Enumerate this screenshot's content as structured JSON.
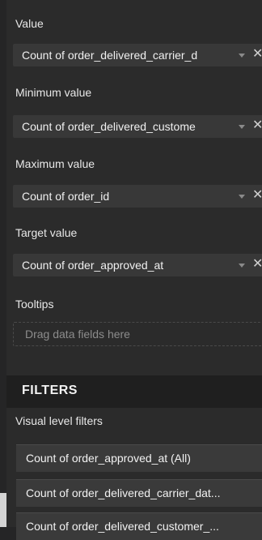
{
  "fields": {
    "value": {
      "label": "Value",
      "field": "Count of order_delivered_carrier_d"
    },
    "minimum_value": {
      "label": "Minimum value",
      "field": "Count of order_delivered_custome"
    },
    "maximum_value": {
      "label": "Maximum value",
      "field": "Count of order_id"
    },
    "target_value": {
      "label": "Target value",
      "field": "Count of order_approved_at"
    },
    "tooltips": {
      "label": "Tooltips",
      "placeholder": "Drag data fields here"
    }
  },
  "filters": {
    "header": "FILTERS",
    "visual_level_label": "Visual level filters",
    "items": [
      "Count of order_approved_at  (All)",
      "Count of order_delivered_carrier_dat...",
      "Count of order_delivered_customer_..."
    ]
  },
  "icons": {
    "chevron": "chevron-down-icon",
    "remove": "close-icon"
  },
  "colors": {
    "accent": "#f2c811",
    "panel": "#2b2b2b",
    "well": "#383838",
    "header": "#1f1f1f"
  }
}
